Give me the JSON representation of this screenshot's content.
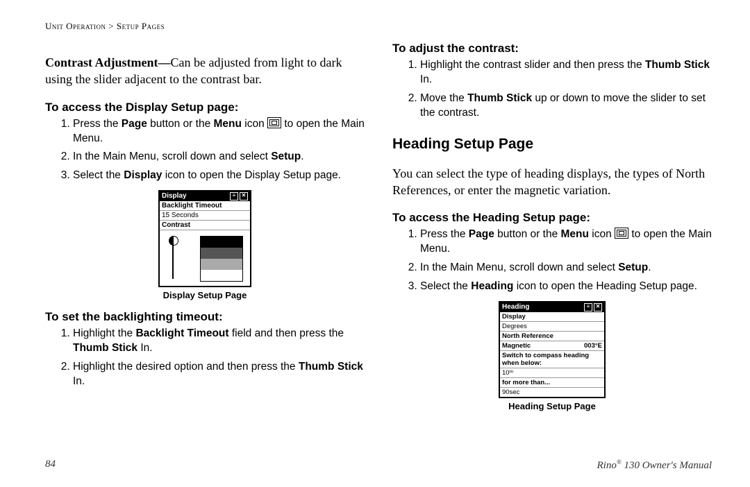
{
  "breadcrumb": {
    "a": "Unit Operation",
    "sep": ">",
    "b": "Setup Pages"
  },
  "left": {
    "intro_lead": "Contrast Adjustment—",
    "intro_body": "Can be adjusted from light to dark using the slider adjacent to the contrast bar.",
    "proc1_head": "To access the Display Setup page:",
    "proc1_s1_a": "Press the ",
    "proc1_s1_b": "Page",
    "proc1_s1_c": " button or the ",
    "proc1_s1_d": "Menu",
    "proc1_s1_e": " icon ",
    "proc1_s1_f": " to open the Main Menu.",
    "proc1_s2_a": "In the Main Menu, scroll down and select ",
    "proc1_s2_b": "Setup",
    "proc1_s2_c": ".",
    "proc1_s3_a": "Select the ",
    "proc1_s3_b": "Display",
    "proc1_s3_c": " icon to open the Display Setup page.",
    "fig1_caption": "Display Setup Page",
    "proc2_head": "To set the backlighting timeout:",
    "proc2_s1_a": "Highlight the ",
    "proc2_s1_b": "Backlight Timeout",
    "proc2_s1_c": " field and then press the ",
    "proc2_s1_d": "Thumb Stick",
    "proc2_s1_e": " In.",
    "proc2_s2_a": "Highlight the desired option and then press the ",
    "proc2_s2_b": "Thumb Stick",
    "proc2_s2_c": " In."
  },
  "right": {
    "proc3_head": "To adjust the contrast:",
    "proc3_s1_a": "Highlight the contrast slider and then press the ",
    "proc3_s1_b": "Thumb Stick",
    "proc3_s1_c": " In.",
    "proc3_s2_a": "Move the ",
    "proc3_s2_b": "Thumb Stick",
    "proc3_s2_c": " up or down to move the slider to set the contrast.",
    "section_head": "Heading Setup Page",
    "section_body": "You can select the type of heading displays, the types of North References, or enter the magnetic variation.",
    "proc4_head": "To access the Heading Setup page:",
    "proc4_s1_a": "Press the ",
    "proc4_s1_b": "Page",
    "proc4_s1_c": " button or the ",
    "proc4_s1_d": "Menu",
    "proc4_s1_e": " icon ",
    "proc4_s1_f": " to open the Main Menu.",
    "proc4_s2_a": "In the Main Menu, scroll down and select ",
    "proc4_s2_b": "Setup",
    "proc4_s2_c": ".",
    "proc4_s3_a": "Select the ",
    "proc4_s3_b": "Heading",
    "proc4_s3_c": " icon to open the Heading Setup page.",
    "fig2_caption": "Heading Setup Page"
  },
  "mini_display": {
    "title": "Display",
    "row1": "Backlight Timeout",
    "row1v": "15 Seconds",
    "row2": "Contrast"
  },
  "mini_heading": {
    "title": "Heading",
    "r1": "Display",
    "r2": "Degrees",
    "r3": "North Reference",
    "r4a": "Magnetic",
    "r4b": "003°E",
    "r5": "Switch to compass heading when below:",
    "r6": "10ᵐ",
    "r7": "for more than...",
    "r8": "90sec"
  },
  "footer": {
    "page": "84",
    "manual_a": "Rino",
    "manual_b": "®",
    "manual_c": " 130 Owner's Manual"
  }
}
